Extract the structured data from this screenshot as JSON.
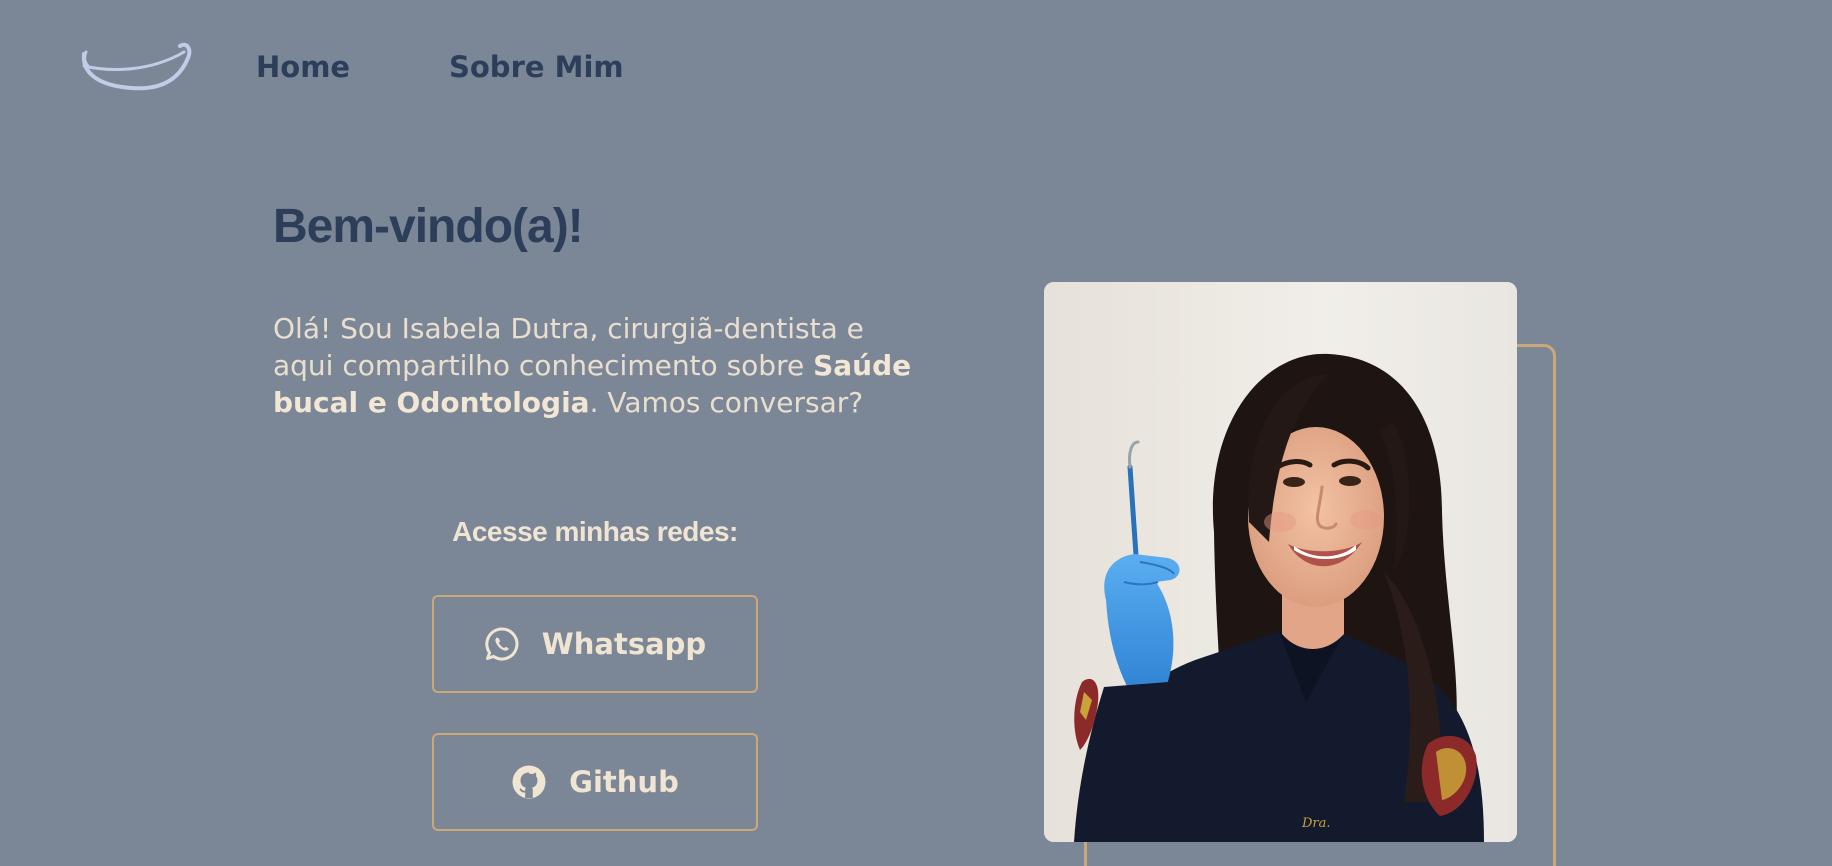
{
  "nav": {
    "logo_icon": "smile-icon",
    "home_label": "Home",
    "about_label": "Sobre Mim"
  },
  "hero": {
    "title": "Bem-vindo(a)!",
    "intro_part1": "Olá! Sou Isabela Dutra, cirurgiã-dentista e aqui compartilho conhecimento sobre ",
    "intro_bold": "Saúde bucal e Odontologia",
    "intro_part2": ". Vamos conversar?",
    "photo_label": "Dra. Isabela Dutra"
  },
  "networks": {
    "label": "Acesse minhas redes:",
    "buttons": [
      {
        "label": "Whatsapp",
        "icon": "whatsapp-icon"
      },
      {
        "label": "Github",
        "icon": "github-icon"
      }
    ]
  },
  "colors": {
    "background": "#7b8796",
    "nav_text": "#2c3e5a",
    "body_text": "#eadfcf",
    "accent_border": "#c9a977",
    "logo_stroke": "#c3cbe6"
  }
}
